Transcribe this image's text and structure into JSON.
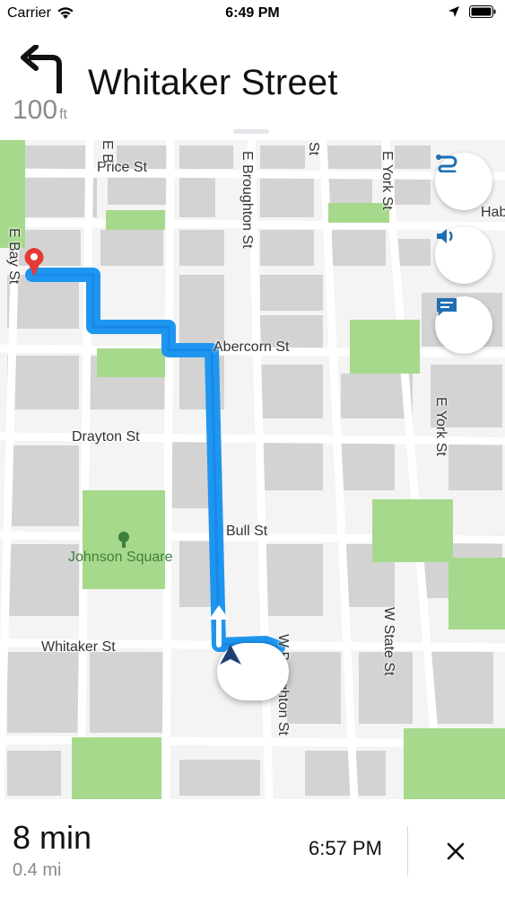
{
  "status_bar": {
    "carrier": "Carrier",
    "time": "6:49 PM"
  },
  "instruction": {
    "distance": "100",
    "unit": "ft",
    "street": "Whitaker Street",
    "maneuver_icon": "turn-left-icon"
  },
  "map": {
    "street_labels": {
      "price": "Price St",
      "e_b": "E B",
      "e_broughton": "E Broughton St",
      "st_top": "St",
      "e_york_top": "E York St",
      "hab": "Hab",
      "e_bay": "E Bay St",
      "abercorn": "Abercorn St",
      "e_york_mid": "E York St",
      "drayton": "Drayton St",
      "bull": "Bull St",
      "w_state": "W State St",
      "whitaker": "Whitaker St",
      "broughton_bottom": "W Broughton St"
    },
    "park_label": "Johnson Square",
    "route_color": "#1e96f0",
    "park_color": "#a6d98c",
    "buttons": [
      "route-overview-icon",
      "speaker-icon",
      "message-icon"
    ]
  },
  "bottom": {
    "eta": "8 min",
    "distance": "0.4 mi",
    "arrival": "6:57 PM"
  }
}
